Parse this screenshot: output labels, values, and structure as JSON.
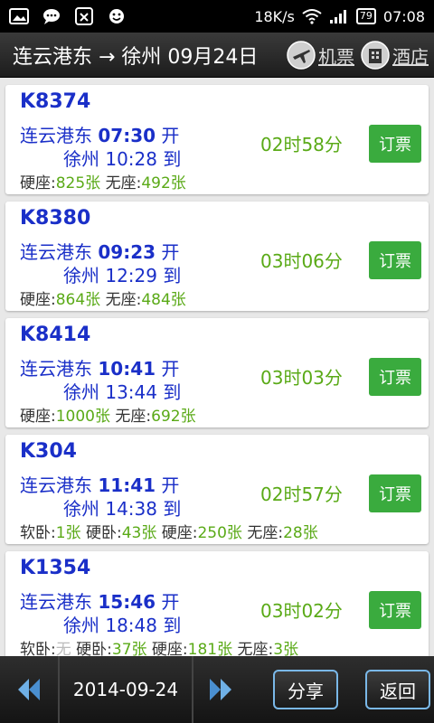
{
  "status_bar": {
    "speed": "18K/s",
    "battery": "79",
    "time": "07:08"
  },
  "header": {
    "title": "连云港东 → 徐州 09月24日",
    "flight_label": "机票",
    "hotel_label": "酒店"
  },
  "trains": [
    {
      "number": "K8374",
      "dep_station": "连云港东",
      "dep_time": "07:30",
      "dep_suffix": "开",
      "arr_station": "徐州",
      "arr_time": "10:28",
      "arr_suffix": "到",
      "duration": "02时58分",
      "book_label": "订票",
      "seats": [
        {
          "type": "硬座",
          "count": "825张"
        },
        {
          "type": "无座",
          "count": "492张"
        }
      ]
    },
    {
      "number": "K8380",
      "dep_station": "连云港东",
      "dep_time": "09:23",
      "dep_suffix": "开",
      "arr_station": "徐州",
      "arr_time": "12:29",
      "arr_suffix": "到",
      "duration": "03时06分",
      "book_label": "订票",
      "seats": [
        {
          "type": "硬座",
          "count": "864张"
        },
        {
          "type": "无座",
          "count": "484张"
        }
      ]
    },
    {
      "number": "K8414",
      "dep_station": "连云港东",
      "dep_time": "10:41",
      "dep_suffix": "开",
      "arr_station": "徐州",
      "arr_time": "13:44",
      "arr_suffix": "到",
      "duration": "03时03分",
      "book_label": "订票",
      "seats": [
        {
          "type": "硬座",
          "count": "1000张"
        },
        {
          "type": "无座",
          "count": "692张"
        }
      ]
    },
    {
      "number": "K304",
      "dep_station": "连云港东",
      "dep_time": "11:41",
      "dep_suffix": "开",
      "arr_station": "徐州",
      "arr_time": "14:38",
      "arr_suffix": "到",
      "duration": "02时57分",
      "book_label": "订票",
      "seats": [
        {
          "type": "软卧",
          "count": "1张"
        },
        {
          "type": "硬卧",
          "count": "43张"
        },
        {
          "type": "硬座",
          "count": "250张"
        },
        {
          "type": "无座",
          "count": "28张"
        }
      ]
    },
    {
      "number": "K1354",
      "dep_station": "连云港东",
      "dep_time": "15:46",
      "dep_suffix": "开",
      "arr_station": "徐州",
      "arr_time": "18:48",
      "arr_suffix": "到",
      "duration": "03时02分",
      "book_label": "订票",
      "seats": [
        {
          "type": "软卧",
          "count": "无"
        },
        {
          "type": "硬卧",
          "count": "37张"
        },
        {
          "type": "硬座",
          "count": "181张"
        },
        {
          "type": "无座",
          "count": "3张"
        }
      ]
    }
  ],
  "footer": {
    "date": "2014-09-24",
    "share_label": "分享",
    "back_label": "返回"
  },
  "colors": {
    "train_blue": "#1a2fc8",
    "value_green": "#5aaa17",
    "button_green": "#3aab3e",
    "button_border": "#7ab8e8",
    "unavailable_grey": "#bbbbbb"
  }
}
